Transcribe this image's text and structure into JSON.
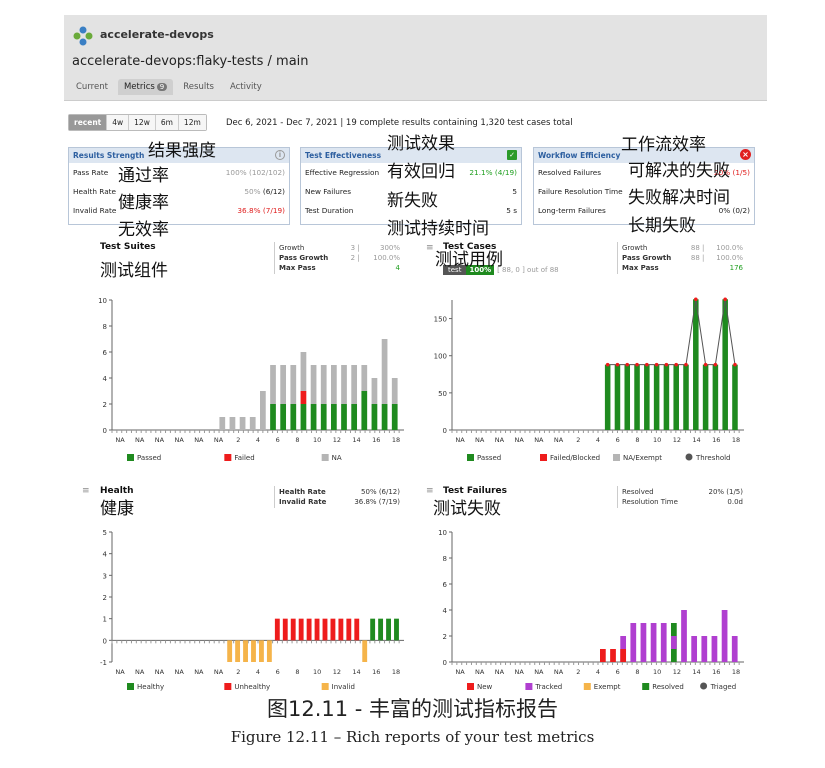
{
  "header": {
    "org": "accelerate-devops",
    "repo": "accelerate-devops:flaky-tests / main",
    "tabs": [
      {
        "label": "Current"
      },
      {
        "label": "Metrics",
        "badge": "9"
      },
      {
        "label": "Results"
      },
      {
        "label": "Activity"
      }
    ]
  },
  "range": {
    "options": [
      "recent",
      "4w",
      "12w",
      "6m",
      "12m"
    ],
    "selected": "recent",
    "summary": "Dec 6, 2021 - Dec 7, 2021 | 19 complete results containing 1,320 test cases total"
  },
  "cards": [
    {
      "title": "Results Strength",
      "rows": [
        {
          "label": "Pass Rate",
          "muted": "100%",
          "value": "(102/102)"
        },
        {
          "label": "Health Rate",
          "muted": "50%",
          "value": "(6/12)"
        },
        {
          "label": "Invalid Rate",
          "value": "36.8% (7/19)"
        }
      ]
    },
    {
      "title": "Test Effectiveness",
      "rows": [
        {
          "label": "Effective Regression",
          "value": "21.1% (4/19)"
        },
        {
          "label": "New Failures",
          "value": "5"
        },
        {
          "label": "Test Duration",
          "value": "5 s"
        }
      ]
    },
    {
      "title": "Workflow Efficiency",
      "rows": [
        {
          "label": "Resolved Failures",
          "value": "20% (1/5)"
        },
        {
          "label": "Failure Resolution Time",
          "value": ""
        },
        {
          "label": "Long-term Failures",
          "value": "0% (0/2)"
        }
      ]
    }
  ],
  "cn": {
    "results_strength": "结果强度",
    "pass_rate": "通过率",
    "health_rate": "健康率",
    "invalid_rate": "无效率",
    "test_effect": "测试效果",
    "eff_reg": "有效回归",
    "new_fail": "新失败",
    "duration": "测试持续时间",
    "workflow": "工作流效率",
    "resolvable": "可解决的失败",
    "res_time": "失败解决时间",
    "long_term": "长期失败",
    "suites": "测试组件",
    "cases": "测试用例",
    "health": "健康",
    "failures": "测试失败"
  },
  "panels": {
    "suites": {
      "title": "Test Suites",
      "stats": [
        [
          "Growth",
          "3 |",
          "300%"
        ],
        [
          "Pass Growth",
          "2 |",
          "100.0%"
        ],
        [
          "Max Pass",
          "",
          "4"
        ]
      ]
    },
    "cases": {
      "title": "Test Cases",
      "stats": [
        [
          "Growth",
          "88 |",
          "100.0%"
        ],
        [
          "Pass Growth",
          "88 |",
          "100.0%"
        ],
        [
          "Max Pass",
          "",
          "176"
        ]
      ],
      "chip": "test",
      "chip_pct": "100%",
      "chip_rest": "[ 88, 0 ] out of 88"
    },
    "health": {
      "title": "Health",
      "stats": [
        [
          "Health Rate",
          "50% (6/12)"
        ],
        [
          "Invalid Rate",
          "36.8% (7/19)"
        ]
      ]
    },
    "failures": {
      "title": "Test Failures",
      "stats": [
        [
          "Resolved",
          "20% (1/5)"
        ],
        [
          "Resolution Time",
          "0.0d"
        ]
      ]
    }
  },
  "colors": {
    "green": "#1f8a1f",
    "red": "#ee1c1c",
    "gray": "#b5b5b5",
    "orange": "#f5b44a",
    "purple": "#b03fd0",
    "dark": "#555555"
  },
  "xlabels": [
    "NA",
    "NA",
    "NA",
    "NA",
    "NA",
    "NA",
    "2",
    "4",
    "6",
    "8",
    "10",
    "12",
    "14",
    "16",
    "18"
  ],
  "chart_data": [
    {
      "type": "bar",
      "name": "suites",
      "ylim": [
        0,
        10
      ],
      "yticks": [
        0,
        2,
        4,
        6,
        8,
        10
      ],
      "series": [
        {
          "name": "Passed",
          "values": [
            0,
            0,
            0,
            0,
            0,
            0,
            0,
            0,
            0,
            0,
            0,
            0,
            0,
            0,
            0,
            2,
            2,
            2,
            2,
            2,
            2,
            2,
            2,
            2,
            3,
            2,
            2,
            2
          ]
        },
        {
          "name": "Failed",
          "values": [
            0,
            0,
            0,
            0,
            0,
            0,
            0,
            0,
            0,
            0,
            0,
            0,
            0,
            0,
            0,
            0,
            0,
            0,
            1,
            0,
            0,
            0,
            0,
            0,
            0,
            0,
            0,
            0
          ]
        },
        {
          "name": "NA",
          "values": [
            0,
            0,
            0,
            0,
            0,
            0,
            0,
            0,
            0,
            0,
            1,
            1,
            1,
            1,
            3,
            3,
            3,
            3,
            3,
            3,
            3,
            3,
            3,
            3,
            2,
            2,
            5,
            2
          ]
        }
      ],
      "legend": [
        "Passed",
        "Failed",
        "NA"
      ]
    },
    {
      "type": "bar",
      "name": "cases",
      "ylim": [
        0,
        175
      ],
      "yticks": [
        0,
        50,
        100,
        150
      ],
      "series": [
        {
          "name": "Passed",
          "values": [
            0,
            0,
            0,
            0,
            0,
            0,
            0,
            0,
            0,
            0,
            0,
            0,
            0,
            0,
            0,
            88,
            88,
            88,
            88,
            88,
            88,
            88,
            88,
            88,
            176,
            88,
            88,
            176,
            88
          ]
        },
        {
          "name": "Threshold",
          "values": [
            0,
            0,
            0,
            0,
            0,
            0,
            0,
            0,
            0,
            0,
            0,
            0,
            0,
            0,
            0,
            88,
            88,
            88,
            88,
            88,
            88,
            88,
            88,
            88,
            176,
            88,
            88,
            176,
            88
          ]
        }
      ],
      "legend": [
        "Passed",
        "Failed/Blocked",
        "NA/Exempt",
        "Threshold"
      ]
    },
    {
      "type": "bar",
      "name": "health",
      "ylim": [
        -1,
        5
      ],
      "yticks": [
        -1,
        0,
        1,
        2,
        3,
        4,
        5
      ],
      "values": [
        0,
        0,
        0,
        0,
        0,
        0,
        0,
        0,
        0,
        0,
        0,
        0,
        0,
        0,
        -1,
        -1,
        -1,
        -1,
        -1,
        -1,
        1,
        1,
        1,
        1,
        1,
        1,
        1,
        1,
        1,
        1,
        1,
        -1,
        1,
        1,
        1,
        1
      ],
      "kinds": [
        "",
        "",
        "",
        "",
        "",
        "",
        "",
        "",
        "",
        "",
        "",
        "",
        "",
        "",
        "i",
        "i",
        "i",
        "i",
        "i",
        "i",
        "u",
        "u",
        "u",
        "u",
        "u",
        "u",
        "u",
        "u",
        "u",
        "u",
        "u",
        "i",
        "h",
        "h",
        "h",
        "h"
      ],
      "legend": [
        "Healthy",
        "Unhealthy",
        "Invalid"
      ]
    },
    {
      "type": "bar",
      "name": "failures",
      "ylim": [
        0,
        10
      ],
      "yticks": [
        0,
        2,
        4,
        6,
        8,
        10
      ],
      "values": [
        0,
        0,
        0,
        0,
        0,
        0,
        0,
        0,
        0,
        0,
        0,
        0,
        0,
        0,
        1,
        1,
        2,
        3,
        3,
        3,
        3,
        3,
        4,
        2,
        2,
        2,
        4,
        2
      ],
      "legend": [
        "New",
        "Tracked",
        "Exempt",
        "Resolved",
        "Triaged"
      ]
    }
  ],
  "caption": {
    "cn": "图12.11 - 丰富的测试指标报告",
    "en": "Figure 12.11 – Rich reports of your test metrics"
  }
}
